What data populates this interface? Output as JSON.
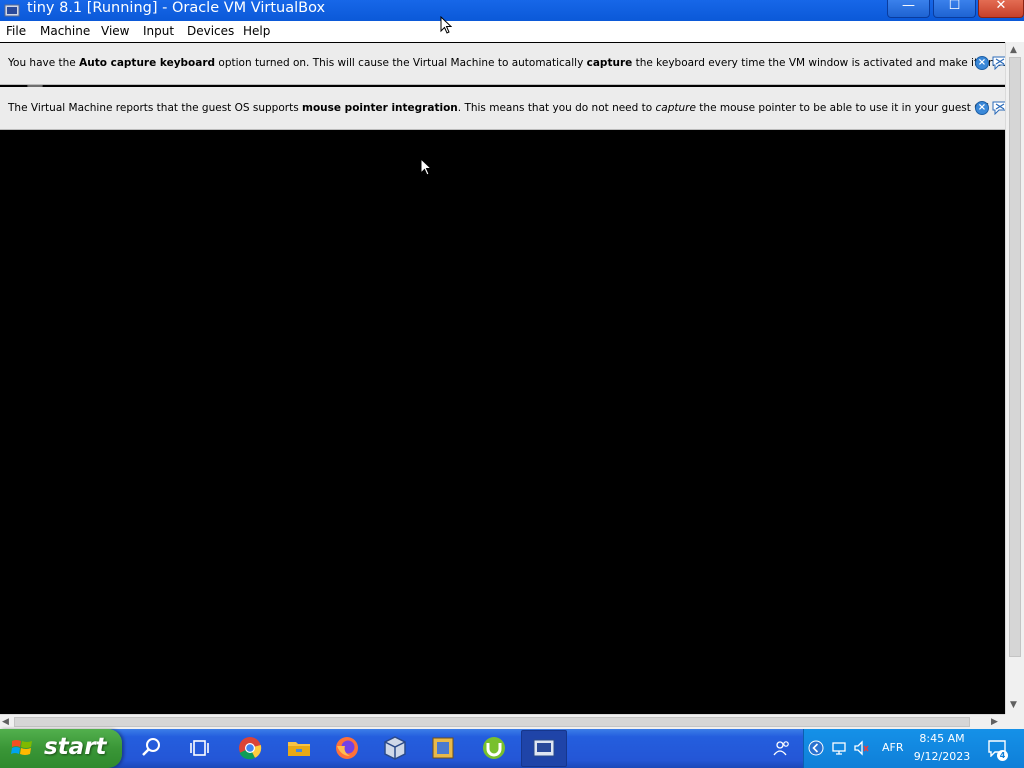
{
  "window": {
    "title": "tiny 8.1 [Running] - Oracle VM VirtualBox",
    "minimize_glyph": "—",
    "maximize_glyph": "☐",
    "close_glyph": "✕"
  },
  "menu": {
    "items": [
      "File",
      "Machine",
      "View",
      "Input",
      "Devices",
      "Help"
    ]
  },
  "notifications": [
    {
      "parts": [
        {
          "text": "You have the ",
          "style": "normal"
        },
        {
          "text": "Auto capture keyboard",
          "style": "bold"
        },
        {
          "text": " option turned on. This will cause the Virtual Machine to automatically ",
          "style": "normal"
        },
        {
          "text": "capture",
          "style": "bold"
        },
        {
          "text": " the keyboard every time the VM window is activated and make it unavailable to",
          "style": "normal"
        }
      ]
    },
    {
      "parts": [
        {
          "text": "The Virtual Machine reports that the guest OS supports ",
          "style": "normal"
        },
        {
          "text": "mouse pointer integration",
          "style": "bold"
        },
        {
          "text": ". This means that you do not need to ",
          "style": "normal"
        },
        {
          "text": "capture",
          "style": "italic"
        },
        {
          "text": " the mouse pointer to be able to use it in your guest OS -- all mouse",
          "style": "normal"
        }
      ]
    }
  ],
  "icons": {
    "close_notification": "close-circle-icon",
    "mute_notification": "speech-bubble-mute-icon",
    "recycle_bin": "recycle-bin-icon"
  },
  "taskbar": {
    "start_label": "start",
    "apps": [
      "search-icon",
      "task-view-icon",
      "chrome-icon",
      "file-explorer-icon",
      "firefox-icon",
      "virtualbox-icon",
      "notepad-app-icon",
      "utorrent-icon",
      "vm-window-icon"
    ],
    "tray": {
      "language": "AFR",
      "time": "8:45 AM",
      "date": "9/12/2023",
      "notification_count": "4"
    }
  },
  "colors": {
    "titlebar": "#0b59d8",
    "taskbar": "#245ede",
    "start_button": "#3a9637",
    "tray": "#0f7fd8",
    "vm_background": "#000000"
  }
}
